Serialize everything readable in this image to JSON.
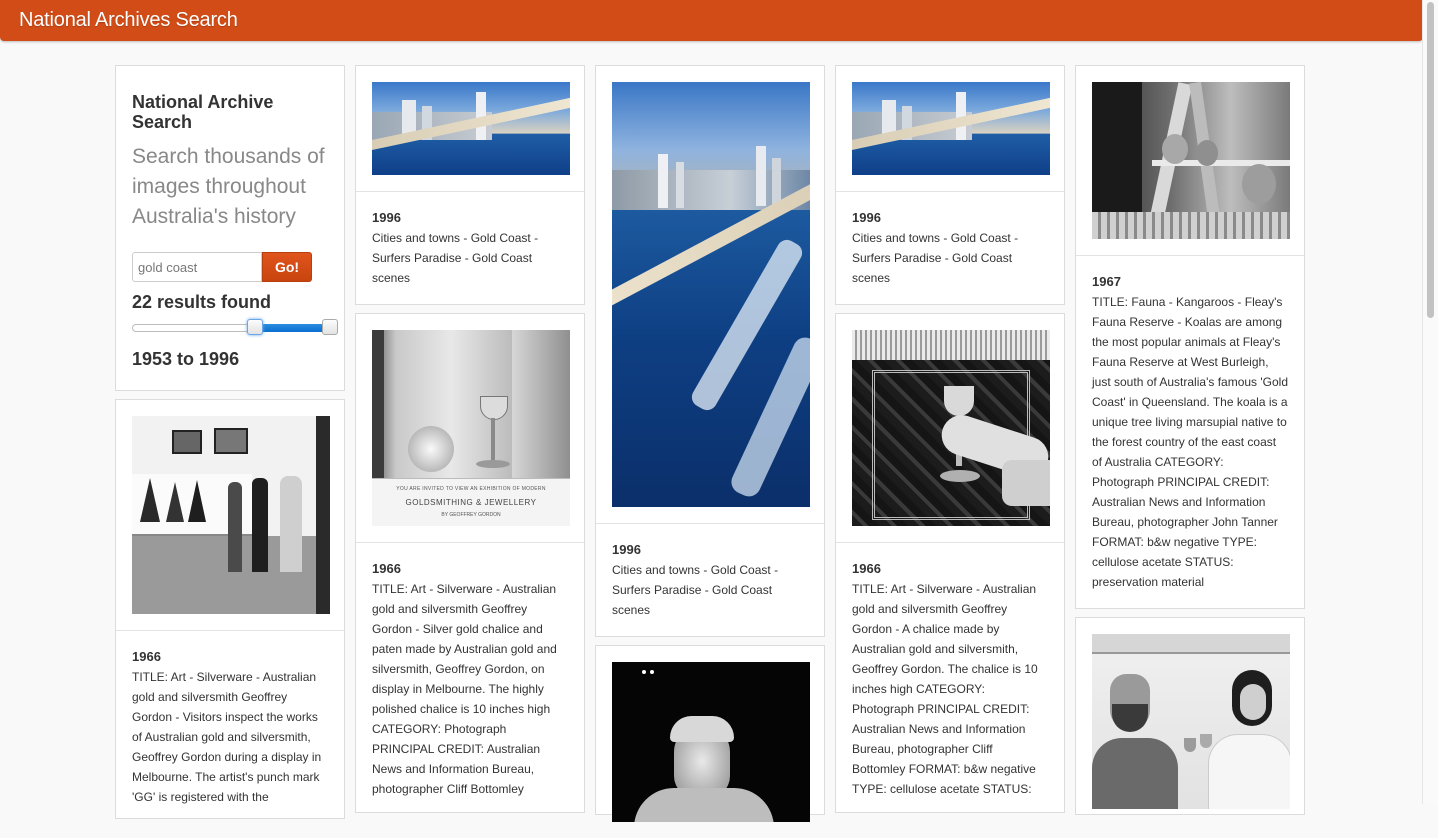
{
  "app": {
    "brand": "National Archives Search"
  },
  "search": {
    "title": "National Archive Search",
    "subtitle": "Search thousands of images throughout Australia's history",
    "query": "gold coast",
    "go_label": "Go!",
    "results_text": "22 results found",
    "range_text": "1953 to 1996",
    "range": {
      "min": 1953,
      "max": 1996,
      "selected_from": 0.6,
      "selected_to": 1.0
    }
  },
  "cards": [
    {
      "year": "1966",
      "description": "TITLE: Art - Silverware - Australian gold and silversmith Geoffrey Gordon - Visitors inspect the works of Australian gold and silversmith, Geoffrey Gordon during a display in Melbourne. The artist's punch mark 'GG' is registered with the",
      "image": "gallery-visitors-photo"
    },
    {
      "year": "1996",
      "description": "Cities and towns - Gold Coast - Surfers Paradise - Gold Coast scenes",
      "image": "coastline-aerial-photo"
    },
    {
      "year": "1966",
      "description": "TITLE: Art - Silverware - Australian gold and silversmith Geoffrey Gordon - Silver gold chalice and paten made by Australian gold and silversmith, Geoffrey Gordon, on display in Melbourne. The highly polished chalice is 10 inches high CATEGORY: Photograph PRINCIPAL CREDIT: Australian News and Information Bureau, photographer Cliff Bottomley",
      "image": "chalice-display-photo",
      "sign_text_1": "YOU ARE INVITED TO VIEW AN EXHIBITION OF MODERN",
      "sign_text_2": "GOLDSMITHING & JEWELLERY",
      "sign_text_3": "BY GEOFFREY GORDON"
    },
    {
      "year": "1996",
      "description": "Cities and towns - Gold Coast - Surfers Paradise - Gold Coast scenes",
      "image": "coastline-aerial-tall-photo"
    },
    {
      "image": "portrait-man-photo"
    },
    {
      "year": "1996",
      "description": "Cities and towns - Gold Coast - Surfers Paradise - Gold Coast scenes",
      "image": "coastline-aerial-photo"
    },
    {
      "year": "1966",
      "description": "TITLE: Art - Silverware - Australian gold and silversmith Geoffrey Gordon - A chalice made by Australian gold and silversmith, Geoffrey Gordon. The chalice is 10 inches high CATEGORY: Photograph PRINCIPAL CREDIT: Australian News and Information Bureau, photographer Cliff Bottomley FORMAT: b&w negative TYPE: cellulose acetate STATUS:",
      "image": "chalice-hand-photo"
    },
    {
      "year": "1967",
      "description": "TITLE: Fauna - Kangaroos - Fleay's Fauna Reserve - Koalas are among the most popular animals at Fleay's Fauna Reserve at West Burleigh, just south of Australia's famous 'Gold Coast' in Queensland. The koala is a unique tree living marsupial native to the forest country of the east coast of Australia CATEGORY: Photograph PRINCIPAL CREDIT: Australian News and Information Bureau, photographer John Tanner FORMAT: b&w negative TYPE: cellulose acetate STATUS: preservation material",
      "image": "koalas-photo"
    },
    {
      "image": "couple-toast-photo"
    }
  ]
}
